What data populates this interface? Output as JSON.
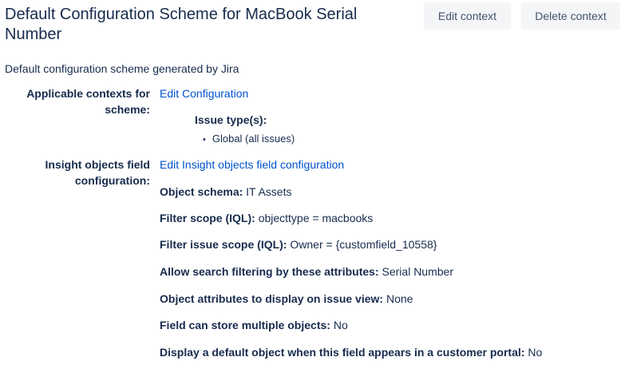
{
  "page": {
    "title": "Default Configuration Scheme for MacBook Serial Number",
    "description": "Default configuration scheme generated by Jira"
  },
  "actions": {
    "edit_context": "Edit context",
    "delete_context": "Delete context"
  },
  "contexts": {
    "label": "Applicable contexts for scheme:",
    "link": "Edit Configuration",
    "issue_types_heading": "Issue type(s):",
    "issue_types": [
      "Global (all issues)"
    ]
  },
  "insight": {
    "label": "Insight objects field configuration:",
    "link": "Edit Insight objects field configuration",
    "fields": [
      {
        "key": "Object schema:",
        "value": "IT Assets"
      },
      {
        "key": "Filter scope (IQL):",
        "value": "objecttype = macbooks"
      },
      {
        "key": "Filter issue scope (IQL):",
        "value": "Owner = {customfield_10558}"
      },
      {
        "key": "Allow search filtering by these attributes:",
        "value": "Serial Number"
      },
      {
        "key": "Object attributes to display on issue view:",
        "value": "None"
      },
      {
        "key": "Field can store multiple objects:",
        "value": "No"
      },
      {
        "key": "Display a default object when this field appears in a customer portal:",
        "value": "No"
      }
    ]
  },
  "colors": {
    "text": "#172b4d",
    "link": "#0052cc",
    "button_bg": "#f4f5f7",
    "button_text": "#42526e"
  }
}
